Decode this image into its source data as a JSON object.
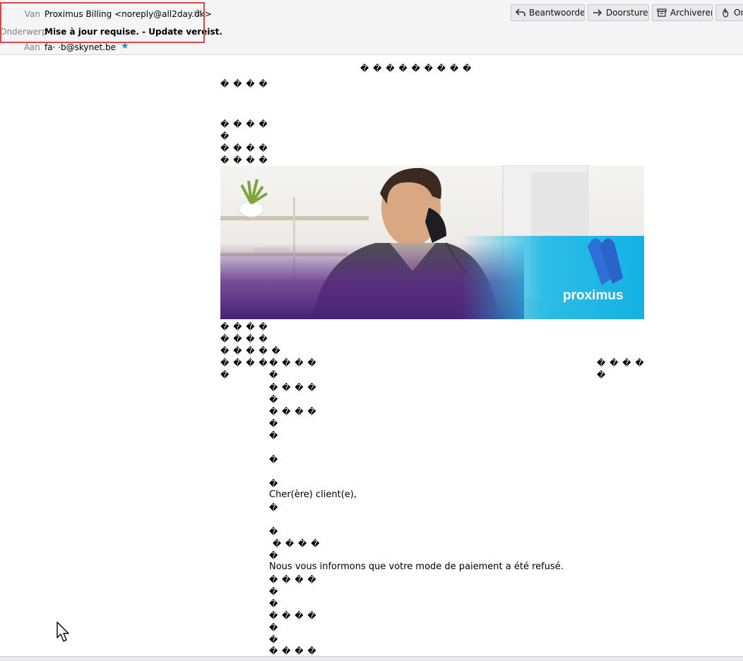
{
  "header": {
    "from_label": "Van",
    "subject_label": "Onderwerp",
    "to_label": "Aan",
    "from_value": "Proximus Billing <noreply@all2day.dk>",
    "subject_value": "Mise à jour requise. - Update vereist.",
    "to_value": "fa·    ·b@skynet.be",
    "star_icon": "star-outline-icon",
    "contact_icon": "blue-star-icon"
  },
  "toolbar": {
    "reply_label": "Beantwoorden",
    "forward_label": "Doorsturen",
    "archive_label": "Archiveren",
    "other_label": "Ongewenst",
    "reply_icon": "reply-arrow-icon",
    "forward_icon": "forward-arrow-icon",
    "archive_icon": "archive-box-icon",
    "other_icon": "flame-icon"
  },
  "message": {
    "glyph_row_centered": "� � � � � � � � �",
    "glyph_4": "� � � �",
    "glyph_5": "� � � � �",
    "glyph_1": "�",
    "glyph_4_indent": " � � � �",
    "greeting": "Cher(ère) client(e),",
    "paragraph_1": "Nous vous informons que votre mode de paiement a été refusé.",
    "banner_logo_text": "proximus",
    "accent_colors": {
      "purple": "#5b2a86",
      "cyan": "#19b9e6",
      "highlight_red": "#d9474b"
    }
  }
}
